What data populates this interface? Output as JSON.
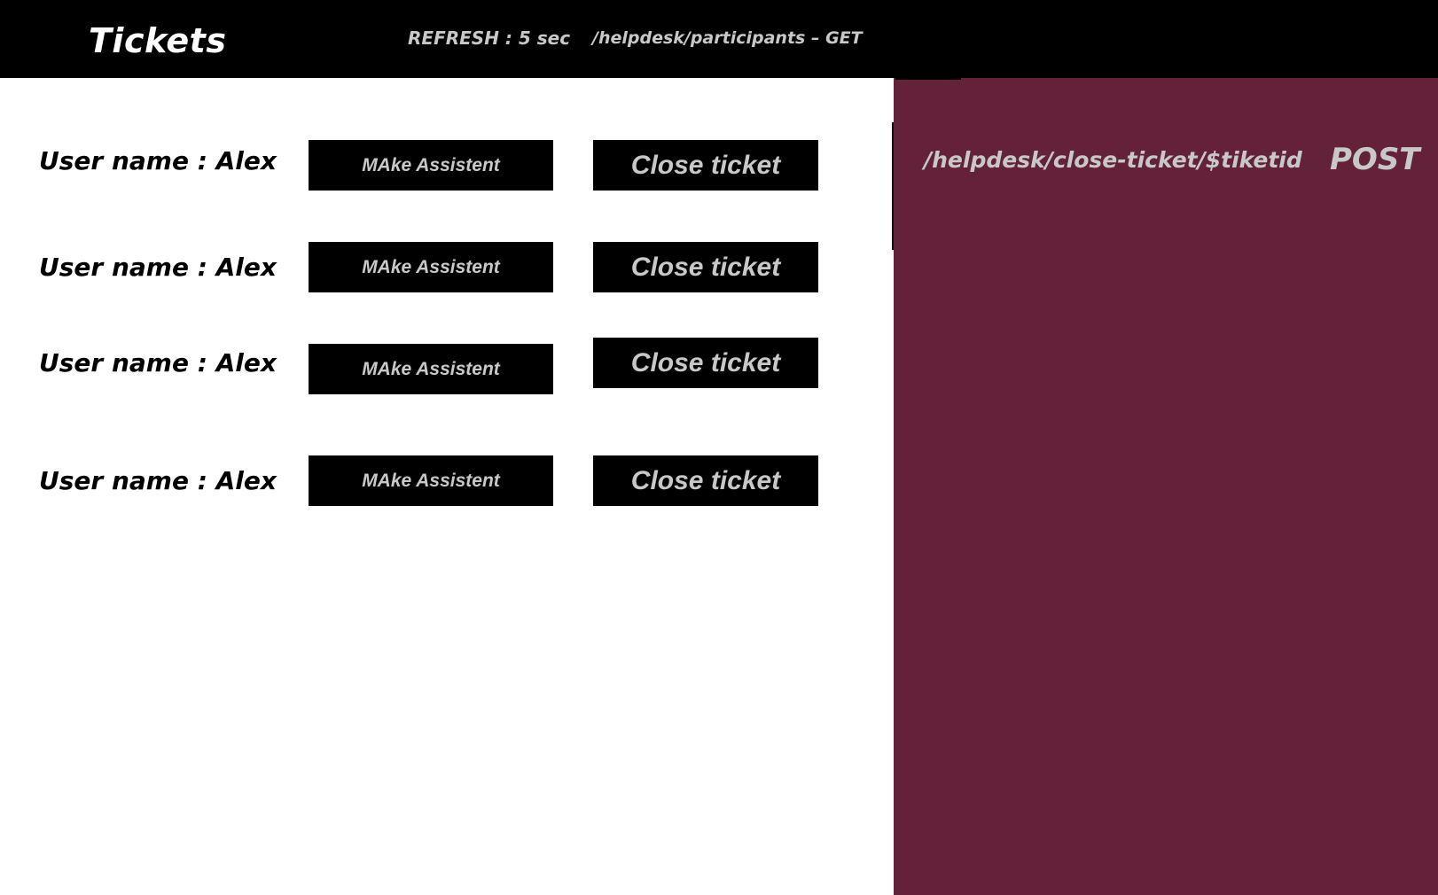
{
  "header": {
    "title": "Tickets",
    "refresh": "REFRESH : 5 sec",
    "endpoint": "/helpdesk/participants – GET"
  },
  "side_panel": {
    "endpoint": "/helpdesk/close-ticket/$tiketid",
    "method": "POST",
    "background_color": "#63223a"
  },
  "tickets": [
    {
      "user_label": "User name : Alex",
      "assist_label": "MAke Assistent",
      "close_label": "Close ticket"
    },
    {
      "user_label": "User name : Alex",
      "assist_label": "MAke Assistent",
      "close_label": "Close ticket"
    },
    {
      "user_label": "User name : Alex",
      "assist_label": "MAke Assistent",
      "close_label": "Close ticket"
    },
    {
      "user_label": "User name : Alex",
      "assist_label": "MAke Assistent",
      "close_label": "Close ticket"
    }
  ],
  "colors": {
    "header_bg": "#000000",
    "button_bg": "#000000",
    "button_text": "#c8c8c8",
    "accent": "#63223a"
  }
}
